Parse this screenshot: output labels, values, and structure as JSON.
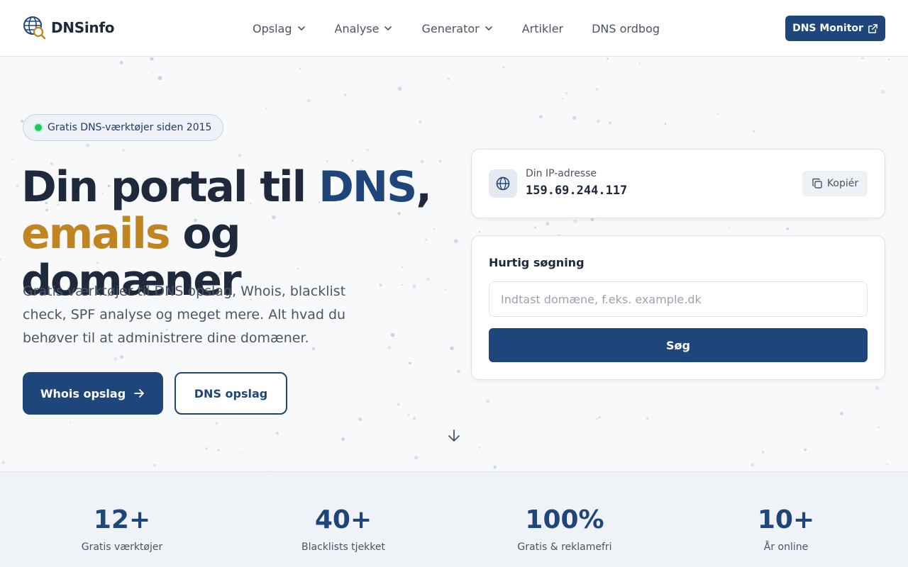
{
  "header": {
    "brand": "DNSinfo",
    "nav": [
      {
        "label": "Opslag",
        "has_dropdown": true
      },
      {
        "label": "Analyse",
        "has_dropdown": true
      },
      {
        "label": "Generator",
        "has_dropdown": true
      },
      {
        "label": "Artikler",
        "has_dropdown": false
      },
      {
        "label": "DNS ordbog",
        "has_dropdown": false
      }
    ],
    "cta_label": "DNS Monitor",
    "cta_icon": "external-link-icon"
  },
  "hero": {
    "badge": "Gratis DNS-værktøjer siden 2015",
    "headline_part1": "Din portal til ",
    "headline_part2": "DNS",
    "headline_part3": ",",
    "headline_part4": "emails",
    "headline_part5": " og domæner",
    "description": "Gratis værktøjer til DNS opslag, Whois, blacklist check, SPF analyse og meget mere. Alt hvad du behøver til at administrere dine domæner.",
    "primary_button": "Whois opslag",
    "secondary_button": "DNS opslag"
  },
  "ip_card": {
    "label": "Din IP-adresse",
    "value": "159.69.244.117",
    "copy_label": "Kopiér",
    "icon": "globe-icon"
  },
  "search_card": {
    "title": "Hurtig søgning",
    "placeholder": "Indtast domæne, f.eks. example.dk",
    "value": "",
    "button": "Søg"
  },
  "stats": [
    {
      "value": "12+",
      "label": "Gratis værktøjer"
    },
    {
      "value": "40+",
      "label": "Blacklists tjekket"
    },
    {
      "value": "100%",
      "label": "Gratis & reklamefri"
    },
    {
      "value": "10+",
      "label": "År online"
    }
  ],
  "colors": {
    "primary": "#1e467a",
    "accent": "#c08421",
    "badge_dot": "#22c55e"
  }
}
